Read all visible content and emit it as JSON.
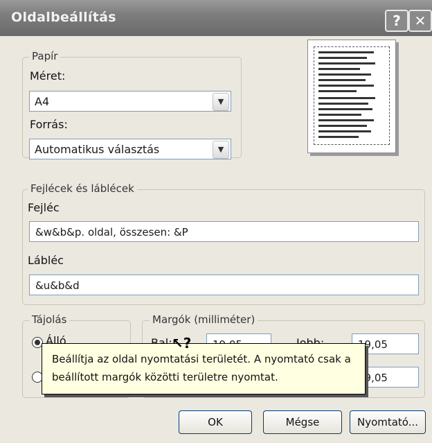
{
  "window": {
    "title": "Oldalbeállítás",
    "help_button": "?",
    "close_button": "✕"
  },
  "paper": {
    "group_label": "Papír",
    "size_label": "Méret:",
    "size_value": "A4",
    "source_label": "Forrás:",
    "source_value": "Automatikus választás"
  },
  "headers_footers": {
    "group_label": "Fejlécek és láblécek",
    "header_label": "Fejléc",
    "header_value": "&w&b&p. oldal, összesen: &P",
    "footer_label": "Lábléc",
    "footer_value": "&u&b&d"
  },
  "orientation": {
    "group_label": "Tájolás",
    "portrait_label": "Álló",
    "portrait_selected": true
  },
  "margins": {
    "group_label": "Margók (milliméter)",
    "left_label": "Bal:",
    "left_value": "19,05",
    "right_label": "Jobb:",
    "right_value": "19,05",
    "bottom_right_value": "19,05"
  },
  "tooltip": {
    "line1": "Beállítja az oldal nyomtatási területét. A nyomtató csak a",
    "line2": "beállított margók közötti területre nyomtat."
  },
  "buttons": {
    "ok": "OK",
    "cancel": "Mégse",
    "printer": "Nyomtató..."
  }
}
